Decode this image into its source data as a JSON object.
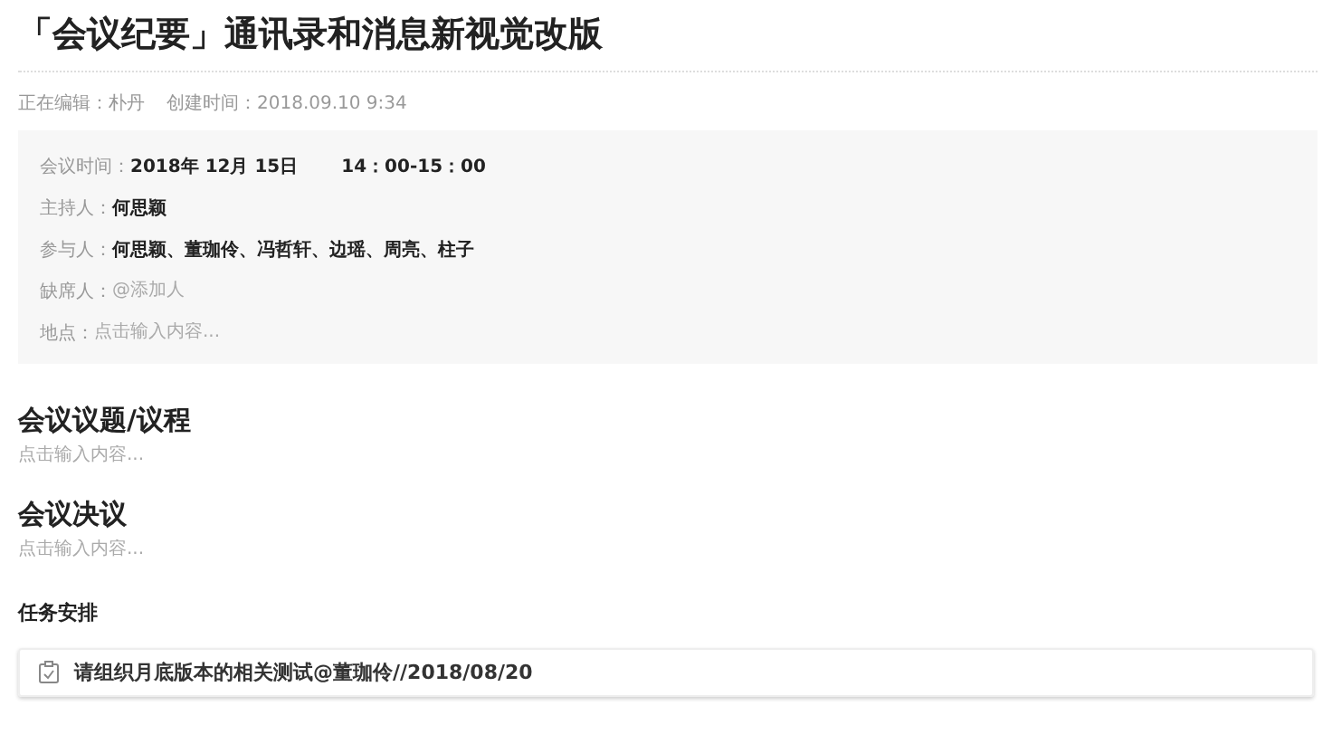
{
  "title": "「会议纪要」通讯录和消息新视觉改版",
  "meta": [
    "正在编辑：朴丹",
    "创建时间：2018.09.10  9:34"
  ],
  "meeting_info": [
    {
      "kind": "values",
      "label": "会议时间：",
      "values": [
        "2018年 12月 15日",
        "14：00-15：00"
      ]
    },
    {
      "kind": "values",
      "label": "主持人：",
      "values": [
        "何思颖"
      ]
    },
    {
      "kind": "values",
      "label": "参与人：",
      "values": [
        "何思颖、董珈伶、冯哲轩、边瑶、周亮、柱子"
      ]
    },
    {
      "kind": "field",
      "label": "缺席人：",
      "placeholder": "@添加人"
    },
    {
      "kind": "field",
      "label": "地点：",
      "placeholder": "点击输入内容..."
    }
  ],
  "sections": [
    {
      "heading": "会议议题/议程",
      "placeholder": "点击输入内容..."
    },
    {
      "heading": "会议决议",
      "placeholder": "点击输入内容..."
    }
  ],
  "tasks": {
    "heading": "任务安排",
    "items": [
      {
        "text": "请组织月底版本的相关测试@董珈伶//2018/08/20"
      }
    ]
  }
}
